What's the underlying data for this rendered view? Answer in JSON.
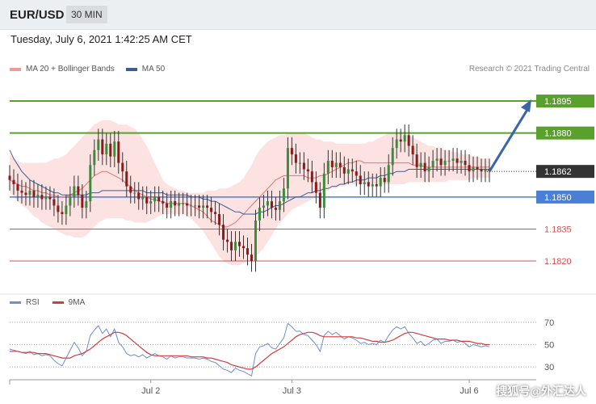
{
  "header": {
    "pair": "EUR/USD",
    "timeframe": "30 MIN"
  },
  "datetime": "Tuesday, July 6, 2021 1:42:25 AM CET",
  "legend": {
    "ma20": "MA 20 + Bollinger Bands",
    "ma50": "MA 50"
  },
  "copyright": "Research © 2021 Trading Central",
  "colors": {
    "ma20": "#e57373",
    "ma50": "#3a5f95",
    "band": "#fde2e2",
    "green_level": "#5aa02c",
    "blue_level": "#4a7fd4",
    "red_level": "#d35050",
    "current": "#333333",
    "arrow": "#3a65a8",
    "candle_up": "#3d8b3d",
    "candle_down": "#8b1a1a",
    "rsi": "#6a8fd4",
    "rsi_ma": "#d33c3c"
  },
  "levels": [
    {
      "value": 1.1895,
      "label": "1.1895",
      "type": "resistance"
    },
    {
      "value": 1.188,
      "label": "1.1880",
      "type": "resistance"
    },
    {
      "value": 1.1862,
      "label": "1.1862",
      "type": "current"
    },
    {
      "value": 1.185,
      "label": "1.1850",
      "type": "pivot"
    },
    {
      "value": 1.1835,
      "label": "1.1835",
      "type": "support"
    },
    {
      "value": 1.182,
      "label": "1.1820",
      "type": "support"
    }
  ],
  "rsi_legend": {
    "rsi": "RSI",
    "ma": "9MA"
  },
  "rsi_axis": {
    "ticks": [
      70,
      50,
      30
    ],
    "labels": [
      "70",
      "50",
      "30"
    ]
  },
  "x_axis": {
    "labels": [
      "Jul 2",
      "Jul 3",
      "Jul 6"
    ],
    "positions": [
      35,
      70,
      114
    ]
  },
  "watermark": "搜狐号@外汇达人",
  "chart_data": {
    "type": "candlestick",
    "title": "EUR/USD",
    "ylim": [
      1.1806,
      1.1906
    ],
    "x_count": 120,
    "close": [
      1.1858,
      1.1856,
      1.1853,
      1.1852,
      1.1851,
      1.1853,
      1.185,
      1.1851,
      1.1849,
      1.185,
      1.1849,
      1.1846,
      1.1843,
      1.1842,
      1.1846,
      1.185,
      1.1855,
      1.1851,
      1.1845,
      1.1848,
      1.1865,
      1.1872,
      1.1877,
      1.187,
      1.1875,
      1.1869,
      1.1876,
      1.1866,
      1.1862,
      1.1855,
      1.1852,
      1.1852,
      1.1849,
      1.185,
      1.1847,
      1.1848,
      1.185,
      1.1848,
      1.1847,
      1.1845,
      1.1848,
      1.1846,
      1.1847,
      1.1847,
      1.1846,
      1.1846,
      1.1846,
      1.1845,
      1.1846,
      1.1845,
      1.1843,
      1.1842,
      1.1837,
      1.183,
      1.1829,
      1.1825,
      1.1829,
      1.1827,
      1.1826,
      1.1823,
      1.182,
      1.1839,
      1.1845,
      1.1846,
      1.1848,
      1.1845,
      1.1844,
      1.1848,
      1.1854,
      1.1873,
      1.187,
      1.1866,
      1.1866,
      1.1863,
      1.1862,
      1.1857,
      1.1852,
      1.1845,
      1.1861,
      1.1867,
      1.1864,
      1.1866,
      1.1864,
      1.1861,
      1.1863,
      1.1862,
      1.186,
      1.1856,
      1.1857,
      1.1855,
      1.1856,
      1.1855,
      1.1859,
      1.1857,
      1.1865,
      1.1873,
      1.1877,
      1.1876,
      1.1879,
      1.1874,
      1.187,
      1.1864,
      1.1866,
      1.1862,
      1.1864,
      1.1867,
      1.1868,
      1.1865,
      1.1867,
      1.1867,
      1.1868,
      1.1866,
      1.1867,
      1.1865,
      1.1862,
      1.1864,
      1.1863,
      1.1862,
      1.1863,
      1.1862
    ],
    "ma20": [
      1.1858,
      1.1857,
      1.1856,
      1.1855,
      1.1855,
      1.1854,
      1.1853,
      1.1853,
      1.1852,
      1.1852,
      1.1851,
      1.1851,
      1.185,
      1.185,
      1.185,
      1.1851,
      1.1852,
      1.1853,
      1.1854,
      1.1856,
      1.1858,
      1.186,
      1.1861,
      1.1862,
      1.1862,
      1.1861,
      1.186,
      1.1859,
      1.1858,
      1.1856,
      1.1855,
      1.1853,
      1.1852,
      1.1851,
      1.185,
      1.1849,
      1.1849,
      1.1848,
      1.1848,
      1.1847,
      1.1847,
      1.1847,
      1.1847,
      1.1847,
      1.1847,
      1.1846,
      1.1845,
      1.1844,
      1.1843,
      1.1841,
      1.1839,
      1.1838,
      1.1837,
      1.1836,
      1.1836,
      1.1837,
      1.1838,
      1.184,
      1.1842,
      1.1844,
      1.1846,
      1.1848,
      1.185,
      1.1852,
      1.1854,
      1.1856,
      1.1858,
      1.1859,
      1.186,
      1.186,
      1.186,
      1.186,
      1.186,
      1.186,
      1.1859,
      1.1859,
      1.1859,
      1.186,
      1.186,
      1.1861,
      1.1862,
      1.1863,
      1.1864,
      1.1865,
      1.1866,
      1.1866,
      1.1867,
      1.1867,
      1.1866,
      1.1866,
      1.1866,
      1.1866,
      1.1866,
      1.1866,
      1.1866,
      1.1866,
      1.1866,
      1.1866,
      1.1866,
      1.1866,
      1.1865,
      1.1865,
      1.1865,
      1.1864,
      1.1864,
      1.1864,
      1.1864,
      1.1864,
      1.1864,
      1.1864,
      1.1864,
      1.1864,
      1.1864,
      1.1864,
      1.1864,
      1.1864,
      1.1864,
      1.1864,
      1.1864,
      1.1864
    ],
    "ma50": [
      1.1872,
      1.1868,
      1.1865,
      1.1862,
      1.186,
      1.1858,
      1.1857,
      1.1856,
      1.1855,
      1.1854,
      1.1853,
      1.1852,
      1.1852,
      1.1851,
      1.1851,
      1.1851,
      1.1851,
      1.1851,
      1.1851,
      1.1851,
      1.1852,
      1.1852,
      1.1852,
      1.1853,
      1.1853,
      1.1853,
      1.1853,
      1.1853,
      1.1853,
      1.1853,
      1.1853,
      1.1853,
      1.1853,
      1.1853,
      1.1852,
      1.1852,
      1.1852,
      1.1852,
      1.1852,
      1.1851,
      1.1851,
      1.1851,
      1.1851,
      1.1851,
      1.1851,
      1.185,
      1.185,
      1.185,
      1.1849,
      1.1849,
      1.1848,
      1.1848,
      1.1847,
      1.1846,
      1.1845,
      1.1844,
      1.1843,
      1.1843,
      1.1842,
      1.1842,
      1.1842,
      1.1842,
      1.1843,
      1.1843,
      1.1844,
      1.1845,
      1.1846,
      1.1846,
      1.1847,
      1.1848,
      1.1849,
      1.185,
      1.185,
      1.1851,
      1.1852,
      1.1852,
      1.1853,
      1.1853,
      1.1854,
      1.1854,
      1.1855,
      1.1855,
      1.1856,
      1.1856,
      1.1857,
      1.1857,
      1.1858,
      1.1858,
      1.1858,
      1.1859,
      1.1859,
      1.1859,
      1.186,
      1.186,
      1.1861,
      1.1861,
      1.1862,
      1.1862,
      1.1862,
      1.1863,
      1.1863,
      1.1863,
      1.1863,
      1.1863,
      1.1863,
      1.1863,
      1.1863,
      1.1863,
      1.1863,
      1.1863,
      1.1863,
      1.1863,
      1.1863,
      1.1863,
      1.1863,
      1.1863,
      1.1863,
      1.1863,
      1.1863,
      1.1863
    ],
    "bb_upper": [
      1.187,
      1.1868,
      1.1867,
      1.1866,
      1.1866,
      1.1866,
      1.1866,
      1.1866,
      1.1866,
      1.1866,
      1.1867,
      1.1868,
      1.1868,
      1.1869,
      1.187,
      1.1872,
      1.1874,
      1.1876,
      1.1878,
      1.188,
      1.1882,
      1.1884,
      1.1885,
      1.1886,
      1.1886,
      1.1886,
      1.1885,
      1.1884,
      1.1884,
      1.1884,
      1.1883,
      1.1882,
      1.188,
      1.1877,
      1.1874,
      1.187,
      1.1866,
      1.1862,
      1.1858,
      1.1856,
      1.1855,
      1.1854,
      1.1853,
      1.1853,
      1.1852,
      1.1852,
      1.1852,
      1.1852,
      1.1852,
      1.1853,
      1.1853,
      1.1853,
      1.1854,
      1.1854,
      1.1854,
      1.1855,
      1.1856,
      1.1857,
      1.1859,
      1.1862,
      1.1865,
      1.1869,
      1.1872,
      1.1874,
      1.1876,
      1.1877,
      1.1878,
      1.1879,
      1.1879,
      1.188,
      1.188,
      1.188,
      1.188,
      1.188,
      1.1879,
      1.1878,
      1.1877,
      1.1877,
      1.1876,
      1.1876,
      1.1876,
      1.1875,
      1.1875,
      1.1875,
      1.1875,
      1.1875,
      1.1875,
      1.1875,
      1.1875,
      1.1876,
      1.1876,
      1.1877,
      1.1878,
      1.1879,
      1.188,
      1.188,
      1.188,
      1.188,
      1.188,
      1.1879,
      1.1878,
      1.1877,
      1.1876,
      1.1875,
      1.1874,
      1.1874,
      1.1873,
      1.1873,
      1.1872,
      1.1872,
      1.1871,
      1.1871,
      1.187,
      1.187,
      1.187,
      1.1869,
      1.1869,
      1.1868,
      1.1868,
      1.1868
    ],
    "bb_lower": [
      1.1852,
      1.185,
      1.1848,
      1.1846,
      1.1845,
      1.1843,
      1.1841,
      1.184,
      1.1838,
      1.1837,
      1.1836,
      1.1835,
      1.1834,
      1.1833,
      1.1832,
      1.1832,
      1.1831,
      1.1831,
      1.1831,
      1.1832,
      1.1834,
      1.1836,
      1.1838,
      1.1839,
      1.184,
      1.184,
      1.184,
      1.184,
      1.184,
      1.1839,
      1.1839,
      1.1838,
      1.1838,
      1.1838,
      1.1838,
      1.1839,
      1.184,
      1.1841,
      1.1842,
      1.1842,
      1.1842,
      1.1842,
      1.1842,
      1.1842,
      1.1841,
      1.184,
      1.1838,
      1.1836,
      1.1834,
      1.1831,
      1.1828,
      1.1825,
      1.1822,
      1.182,
      1.1819,
      1.1818,
      1.1818,
      1.1818,
      1.1819,
      1.182,
      1.1821,
      1.1822,
      1.1824,
      1.1826,
      1.1829,
      1.1832,
      1.1835,
      1.1838,
      1.184,
      1.1842,
      1.1844,
      1.1845,
      1.1846,
      1.1847,
      1.1848,
      1.1849,
      1.185,
      1.1851,
      1.1852,
      1.1853,
      1.1854,
      1.1854,
      1.1855,
      1.1855,
      1.1856,
      1.1856,
      1.1856,
      1.1856,
      1.1856,
      1.1856,
      1.1856,
      1.1856,
      1.1856,
      1.1856,
      1.1856,
      1.1856,
      1.1856,
      1.1856,
      1.1856,
      1.1857,
      1.1857,
      1.1857,
      1.1857,
      1.1857,
      1.1857,
      1.1857,
      1.1857,
      1.1857,
      1.1857,
      1.1858,
      1.1858,
      1.1858,
      1.1858,
      1.1858,
      1.1858,
      1.1859,
      1.1859,
      1.1859,
      1.1859,
      1.1859
    ],
    "projection": {
      "from": 1.1862,
      "to": 1.1895
    },
    "rsi": [
      46,
      45,
      44,
      43,
      42,
      44,
      41,
      42,
      40,
      41,
      40,
      36,
      33,
      31,
      38,
      45,
      52,
      47,
      40,
      44,
      58,
      63,
      67,
      60,
      64,
      57,
      64,
      52,
      48,
      42,
      40,
      41,
      39,
      41,
      38,
      40,
      42,
      40,
      39,
      37,
      40,
      38,
      39,
      39,
      38,
      38,
      38,
      37,
      38,
      37,
      35,
      34,
      31,
      28,
      27,
      25,
      29,
      27,
      26,
      24,
      22,
      42,
      48,
      49,
      51,
      47,
      46,
      51,
      56,
      69,
      66,
      62,
      62,
      59,
      58,
      54,
      50,
      44,
      58,
      62,
      59,
      61,
      58,
      55,
      57,
      56,
      54,
      51,
      52,
      50,
      51,
      50,
      54,
      52,
      58,
      63,
      66,
      64,
      66,
      60,
      56,
      51,
      53,
      49,
      51,
      54,
      55,
      51,
      53,
      53,
      54,
      52,
      53,
      51,
      48,
      50,
      49,
      48,
      49,
      48
    ],
    "rsi_ma": [
      44,
      44,
      44,
      43,
      43,
      43,
      43,
      42,
      42,
      42,
      41,
      40,
      39,
      38,
      38,
      38,
      40,
      41,
      42,
      44,
      46,
      49,
      52,
      55,
      57,
      59,
      61,
      61,
      60,
      58,
      55,
      52,
      49,
      46,
      43,
      41,
      40,
      40,
      40,
      40,
      40,
      40,
      40,
      40,
      40,
      39,
      39,
      39,
      39,
      38,
      38,
      37,
      36,
      35,
      34,
      32,
      31,
      30,
      29,
      28,
      28,
      30,
      33,
      36,
      39,
      42,
      44,
      46,
      48,
      51,
      54,
      57,
      59,
      60,
      61,
      61,
      60,
      58,
      57,
      57,
      57,
      57,
      57,
      57,
      57,
      57,
      56,
      56,
      55,
      54,
      53,
      53,
      52,
      52,
      53,
      54,
      56,
      58,
      60,
      61,
      61,
      60,
      59,
      58,
      57,
      56,
      55,
      55,
      55,
      54,
      54,
      54,
      53,
      53,
      53,
      52,
      51,
      51,
      50,
      50
    ],
    "rsi_ylim": [
      20,
      80
    ]
  }
}
